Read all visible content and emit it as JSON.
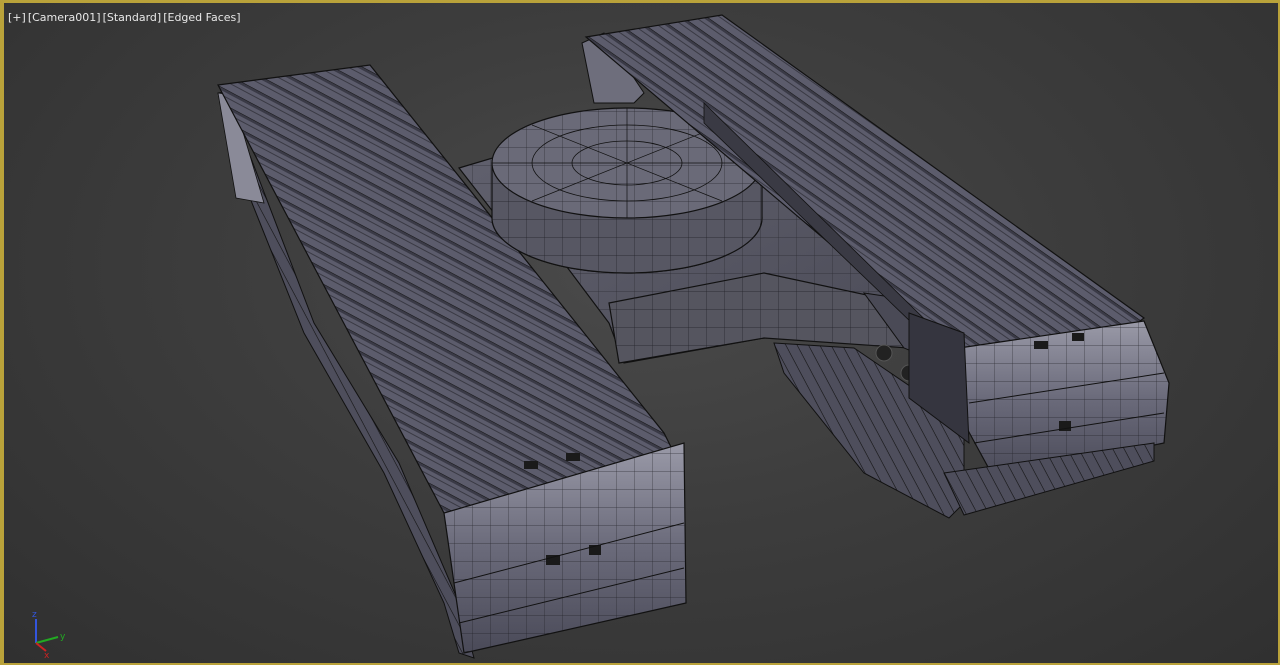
{
  "viewport": {
    "labels": {
      "menu": "[+]",
      "camera": "[Camera001]",
      "shading_standard": "[Standard]",
      "shading_mode": "[Edged Faces]"
    },
    "gizmo": {
      "z": "z",
      "x": "x",
      "y": "y"
    },
    "colors": {
      "frame_border": "#b9a23a",
      "background": "#3d3d3d",
      "model_face": "#5a5a6a",
      "model_edge": "#111111",
      "axis_x": "#cc2222",
      "axis_y": "#22aa22",
      "axis_z": "#3355dd"
    },
    "scene_object": "excavator-undercarriage-icon"
  }
}
